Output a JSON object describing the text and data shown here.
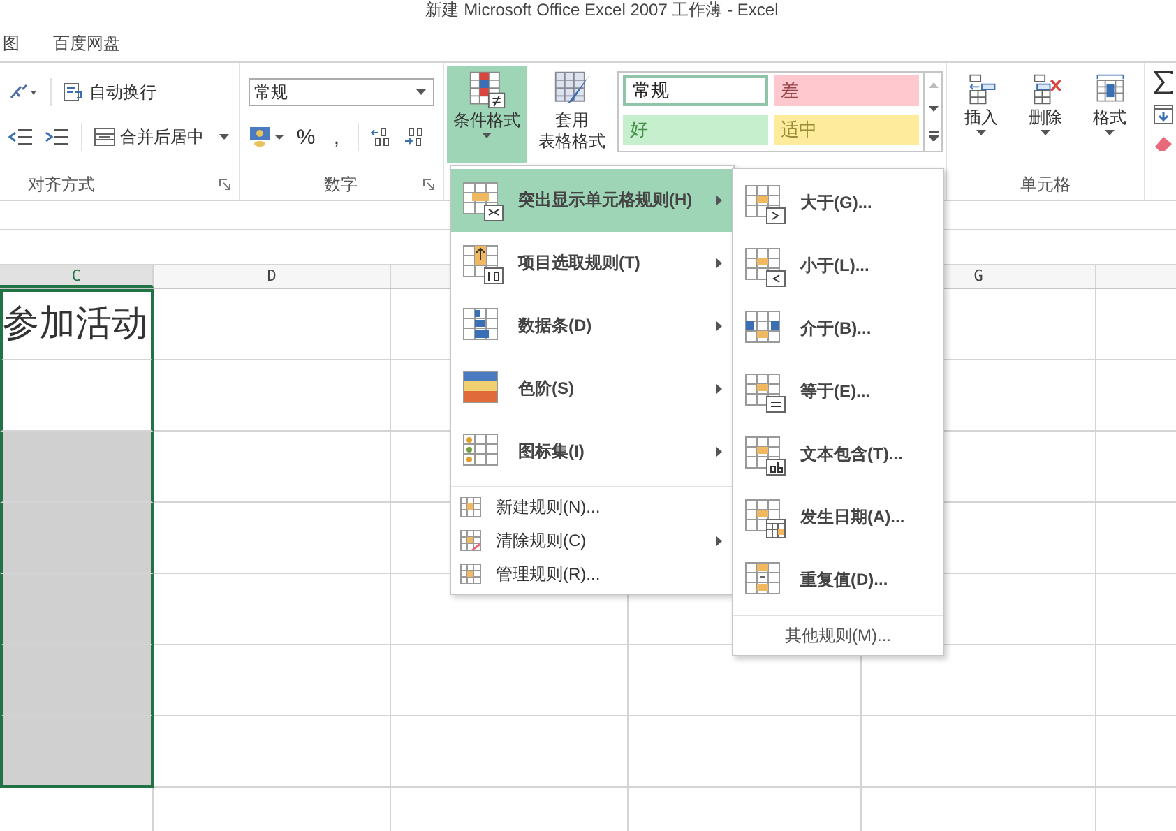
{
  "window": {
    "title": "新建 Microsoft Office Excel 2007 工作薄 - Excel"
  },
  "tabs": [
    {
      "label": "图",
      "selected": false
    },
    {
      "label": "百度网盘",
      "selected": false
    }
  ],
  "ribbon": {
    "alignment": {
      "wrap_text": "自动换行",
      "merge_center": "合并后居中",
      "label": "对齐方式"
    },
    "number": {
      "format": "常规",
      "percent": "%",
      "comma": ",",
      "label": "数字"
    },
    "styles": {
      "conditional_formatting": {
        "label": "条件格式",
        "selected": true
      },
      "format_as_table": [
        "套用",
        "表格格式"
      ],
      "cell_styles": [
        {
          "label": "常规",
          "color": "#ffffff",
          "selected": true
        },
        {
          "label": "差",
          "color": "#ffc7ce",
          "selected": false
        },
        {
          "label": "好",
          "color": "#c6efce",
          "selected": false
        },
        {
          "label": "适中",
          "color": "#ffeb9c",
          "selected": false
        }
      ]
    },
    "cells": {
      "buttons": [
        "插入",
        "删除",
        "格式"
      ],
      "label": "单元格"
    }
  },
  "sheet": {
    "columns": [
      {
        "label": "C",
        "selected": true
      },
      {
        "label": "D",
        "selected": false
      },
      {
        "label": "G",
        "selected": false
      }
    ],
    "rows": [
      {
        "text": "参加活动",
        "shaded": false,
        "selected": true
      },
      {
        "shaded": false,
        "selected": true
      },
      {
        "shaded": true,
        "selected": true
      },
      {
        "shaded": true,
        "selected": true
      },
      {
        "shaded": true,
        "selected": true
      },
      {
        "shaded": true,
        "selected": true
      },
      {
        "shaded": true,
        "selected": true
      }
    ]
  },
  "menu": {
    "items": [
      {
        "kind": "large",
        "label": "突出显示单元格规则(H)",
        "submenu": true,
        "selected": true
      },
      {
        "kind": "large",
        "label": "项目选取规则(T)",
        "submenu": true,
        "selected": false
      },
      {
        "kind": "large",
        "label": "数据条(D)",
        "submenu": true,
        "selected": false
      },
      {
        "kind": "large",
        "label": "色阶(S)",
        "submenu": true,
        "selected": false
      },
      {
        "kind": "large",
        "label": "图标集(I)",
        "submenu": true,
        "selected": false
      },
      {
        "kind": "small",
        "label": "新建规则(N)...",
        "submenu": false,
        "selected": false
      },
      {
        "kind": "small",
        "label": "清除规则(C)",
        "submenu": true,
        "selected": false
      },
      {
        "kind": "small",
        "label": "管理规则(R)...",
        "submenu": false,
        "selected": false
      }
    ]
  },
  "submenu": {
    "items": [
      {
        "kind": "large",
        "label": "大于(G)..."
      },
      {
        "kind": "large",
        "label": "小于(L)..."
      },
      {
        "kind": "large",
        "label": "介于(B)..."
      },
      {
        "kind": "large",
        "label": "等于(E)..."
      },
      {
        "kind": "large",
        "label": "文本包含(T)..."
      },
      {
        "kind": "large",
        "label": "发生日期(A)..."
      },
      {
        "kind": "large",
        "label": "重复值(D)..."
      },
      {
        "kind": "small",
        "label": "其他规则(M)..."
      }
    ]
  }
}
